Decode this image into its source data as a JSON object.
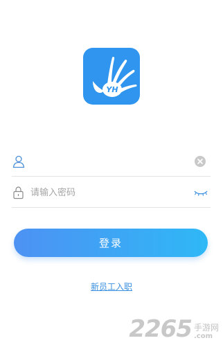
{
  "app": {
    "logo_text": "YH",
    "brand_color": "#2f95ee"
  },
  "form": {
    "username": {
      "icon": "user-icon",
      "value": "",
      "placeholder": "",
      "clear_icon": "clear-icon"
    },
    "password": {
      "icon": "lock-icon",
      "value": "",
      "placeholder": "请输入密码",
      "toggle_icon": "eye-closed-icon"
    }
  },
  "actions": {
    "login_label": "登录",
    "new_employee_label": "新员工入职"
  },
  "watermark": {
    "number": "2265",
    "site": "手游网",
    "domain": ".com"
  },
  "colors": {
    "button_start": "#4d92f3",
    "button_end": "#2fb8f6",
    "link": "#3a8fe0"
  }
}
